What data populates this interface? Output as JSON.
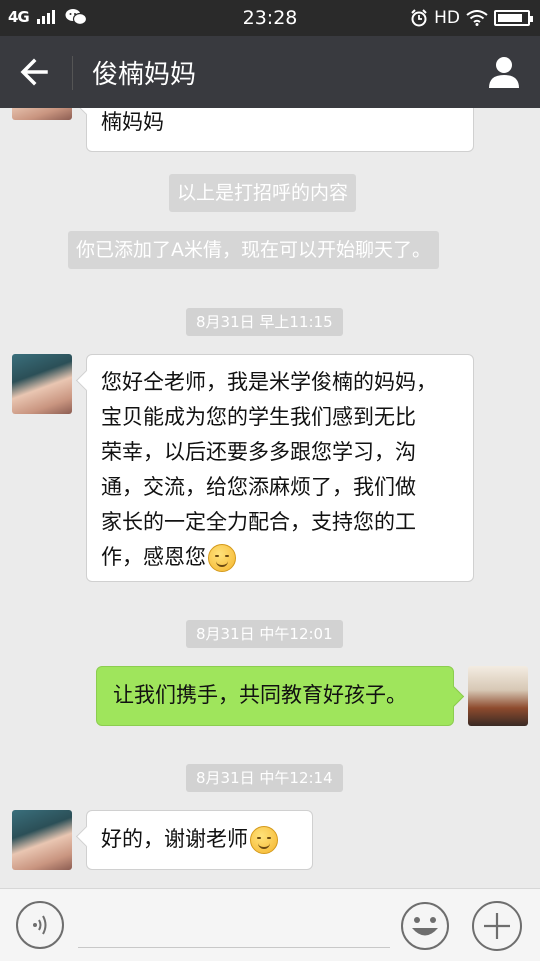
{
  "status_bar": {
    "signal": "4G",
    "time": "23:28",
    "hd": "HD",
    "battery_level": 0.85
  },
  "header": {
    "title": "俊楠妈妈"
  },
  "messages": {
    "m0": {
      "text": "楠妈妈"
    },
    "sys1": "以上是打招呼的内容",
    "sys2": "你已添加了A米倩，现在可以开始聊天了。",
    "ts1": "8月31日 早上11:15",
    "m1": {
      "lines": [
        "您好仝老师，我是米学俊楠的妈妈，",
        "宝贝能成为您的学生我们感到无比",
        "荣幸，以后还要多多跟您学习，沟",
        "通，交流，给您添麻烦了，我们做",
        "家长的一定全力配合，支持您的工",
        "作，感恩您"
      ]
    },
    "ts2": "8月31日 中午12:01",
    "m2": {
      "text": "让我们携手，共同教育好孩子。"
    },
    "ts3": "8月31日 中午12:14",
    "m3": {
      "text": "好的，谢谢老师"
    }
  },
  "icons": {
    "back": "arrow-left-icon",
    "profile": "person-icon",
    "voice": "voice-icon",
    "emoji": "smiley-icon",
    "plus": "plus-icon"
  },
  "colors": {
    "titlebar": "#393a3f",
    "chat_bg": "#ebebeb",
    "sent_bubble": "#9fe55c"
  }
}
